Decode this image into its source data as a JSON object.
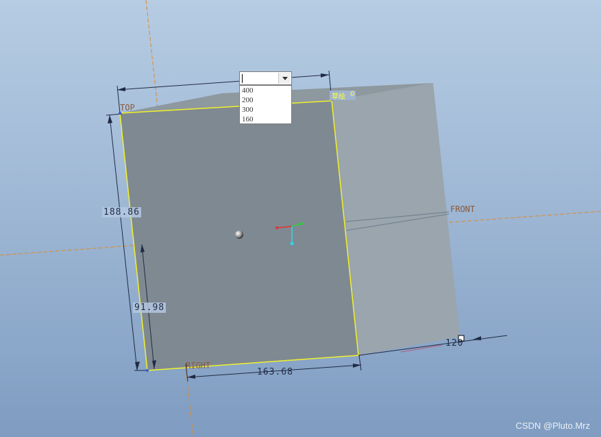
{
  "dimensions": {
    "height_total": "188.86",
    "height_lower": "91.98",
    "width_bottom": "163.68",
    "depth": "120"
  },
  "datum_planes": {
    "top": "TOP",
    "front": "FRONT",
    "right": "RIGHT"
  },
  "dropdown": {
    "current_value": "",
    "options": [
      "400",
      "200",
      "300",
      "160"
    ]
  },
  "plane_tag": {
    "left": "草绘",
    "right": "0"
  },
  "watermark": "CSDN @Pluto.Mrz",
  "colors": {
    "background_top": "#b6cce3",
    "background_bottom": "#7f9cc1",
    "front_face": "#7f8992",
    "side_face": "#9aa5ad",
    "top_face": "#8e989f",
    "sketch_edge": "#f2f22a",
    "datum_line": "#e08a2a"
  }
}
